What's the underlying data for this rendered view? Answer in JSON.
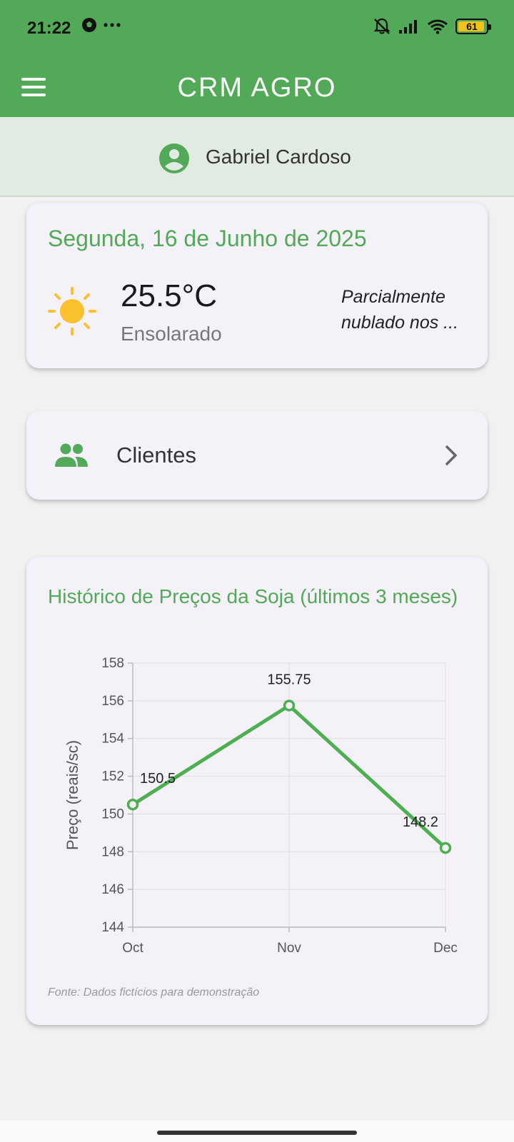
{
  "status_bar": {
    "time": "21:22",
    "left_icons": [
      "football-icon",
      "more-dots-icon"
    ],
    "right_icons": [
      "bell-off-icon",
      "signal-icon",
      "wifi-icon",
      "battery-icon"
    ],
    "battery_level": "61"
  },
  "app_bar": {
    "title": "CRM AGRO",
    "menu_icon": "hamburger-icon"
  },
  "user": {
    "name": "Gabriel Cardoso",
    "icon": "account-circle-icon"
  },
  "weather": {
    "date": "Segunda, 16 de Junho de 2025",
    "temperature": "25.5°C",
    "condition": "Ensolarado",
    "forecast": "Parcialmente nublado nos ...",
    "icon": "sun-icon"
  },
  "clients": {
    "label": "Clientes",
    "icon": "people-icon",
    "chevron": "chevron-right-icon"
  },
  "chart_section": {
    "title": "Histórico de Preços da Soja (últimos 3 meses)",
    "source": "Fonte: Dados fictícios para demonstração"
  },
  "chart_data": {
    "type": "line",
    "categories": [
      "Oct",
      "Nov",
      "Dec"
    ],
    "series": [
      {
        "values": [
          150.5,
          155.75,
          148.2
        ]
      }
    ],
    "data_labels": [
      "150.5",
      "155.75",
      "148.2"
    ],
    "xlabel": "",
    "ylabel": "Preço (reais/sc)",
    "ylim": [
      144,
      158
    ],
    "yticks": [
      144,
      146,
      148,
      150,
      152,
      154,
      156,
      158
    ],
    "grid": true,
    "line_color": "#4caf50"
  },
  "colors": {
    "primary": "#52a957",
    "card_bg": "#f5f1f8",
    "banner_bg": "#e1ebe1",
    "sun": "#fbc02d"
  }
}
